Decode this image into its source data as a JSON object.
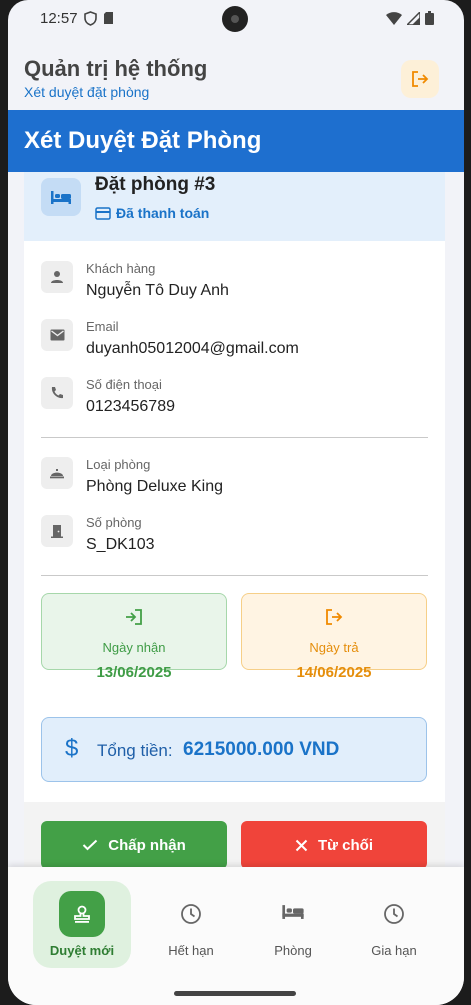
{
  "status_bar": {
    "time": "12:57"
  },
  "app_bar": {
    "title": "Quản trị hệ thống",
    "subtitle": "Xét duyệt đặt phòng"
  },
  "screen_header": {
    "title": "Xét Duyệt Đặt Phòng"
  },
  "booking": {
    "title": "Đặt phòng #3",
    "payment_status": "Đã thanh toán",
    "fields": [
      {
        "label": "Khách hàng",
        "value": "Nguyễn Tô Duy Anh",
        "icon": "person-icon"
      },
      {
        "label": "Email",
        "value": "duyanh05012004@gmail.com",
        "icon": "email-icon"
      },
      {
        "label": "Số điện thoại",
        "value": "0123456789",
        "icon": "phone-icon"
      },
      {
        "label": "Loại phòng",
        "value": "Phòng Deluxe King",
        "icon": "room-service-icon"
      },
      {
        "label": "Số phòng",
        "value": "S_DK103",
        "icon": "door-icon"
      }
    ],
    "check_in": {
      "label": "Ngày nhận",
      "value": "13/06/2025"
    },
    "check_out": {
      "label": "Ngày trả",
      "value": "14/06/2025"
    },
    "total": {
      "symbol": "$",
      "label": "Tổng tiền:",
      "value": "6215000.000 VND"
    }
  },
  "actions": {
    "accept": "Chấp nhận",
    "reject": "Từ chối"
  },
  "bottom_nav": [
    {
      "label": "Duyệt mới",
      "icon": "approval-icon",
      "active": true
    },
    {
      "label": "Hết hạn",
      "icon": "clock-icon",
      "active": false
    },
    {
      "label": "Phòng",
      "icon": "bed-icon",
      "active": false
    },
    {
      "label": "Gia hạn",
      "icon": "clock-icon",
      "active": false
    }
  ],
  "colors": {
    "primary": "#1e6fcf",
    "success": "#43a047",
    "danger": "#f0443a",
    "warning": "#e58e0c"
  }
}
